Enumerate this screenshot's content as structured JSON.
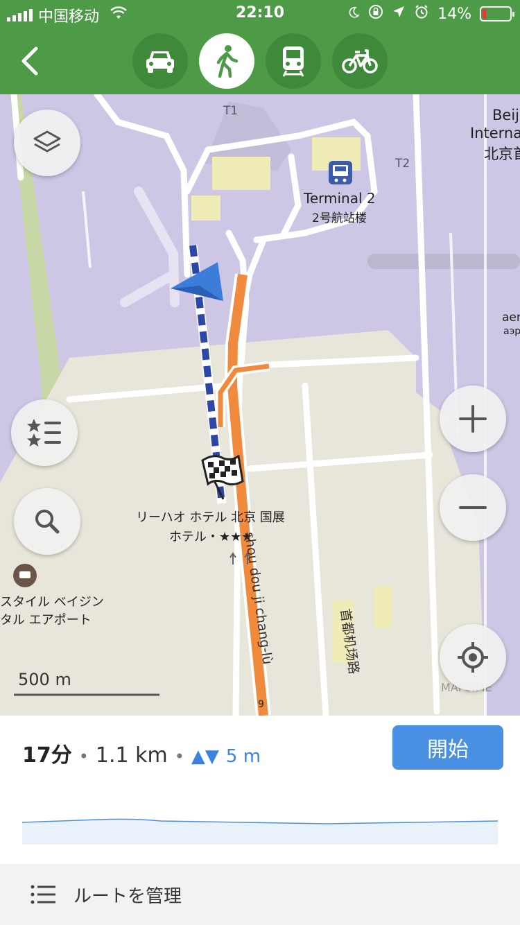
{
  "status_bar": {
    "carrier": "中国移动",
    "time": "22:10",
    "battery": "14%",
    "battery_level": 0.14
  },
  "transport_modes": [
    {
      "name": "car",
      "active": false
    },
    {
      "name": "walk",
      "active": true
    },
    {
      "name": "transit",
      "active": false
    },
    {
      "name": "bike",
      "active": false
    }
  ],
  "map": {
    "labels": {
      "t1": "T1",
      "t2": "T2",
      "terminal2_en": "Terminal 2",
      "terminal2_cn": "2号航站楼",
      "beijing_line1": "Beij",
      "beijing_line2": "Interna",
      "beijing_line3": "北京首",
      "right_edge1": "aer",
      "right_edge2": "аэр",
      "destination_line1": "リーハオ ホテル 北京 国展",
      "destination_line2": "ホテル・★★★",
      "road_name": "shou dou ji chang-lù",
      "road_name_cn": "首都机场路",
      "poi_line1": "スタイル ベイジン",
      "poi_line2": "タル エアポート",
      "route_number": "9",
      "watermark": "MAPS.ME"
    },
    "scale": "500 m"
  },
  "route_summary": {
    "time": "17分",
    "distance": "1.1 km",
    "elevation": "5 m",
    "start_button": "開始"
  },
  "manage_route": "ルートを管理",
  "colors": {
    "header_green": "#4e9b47",
    "accent_blue": "#4a90e2",
    "route_orange": "#f08a3c",
    "walk_route_blue": "#2c47a8"
  }
}
